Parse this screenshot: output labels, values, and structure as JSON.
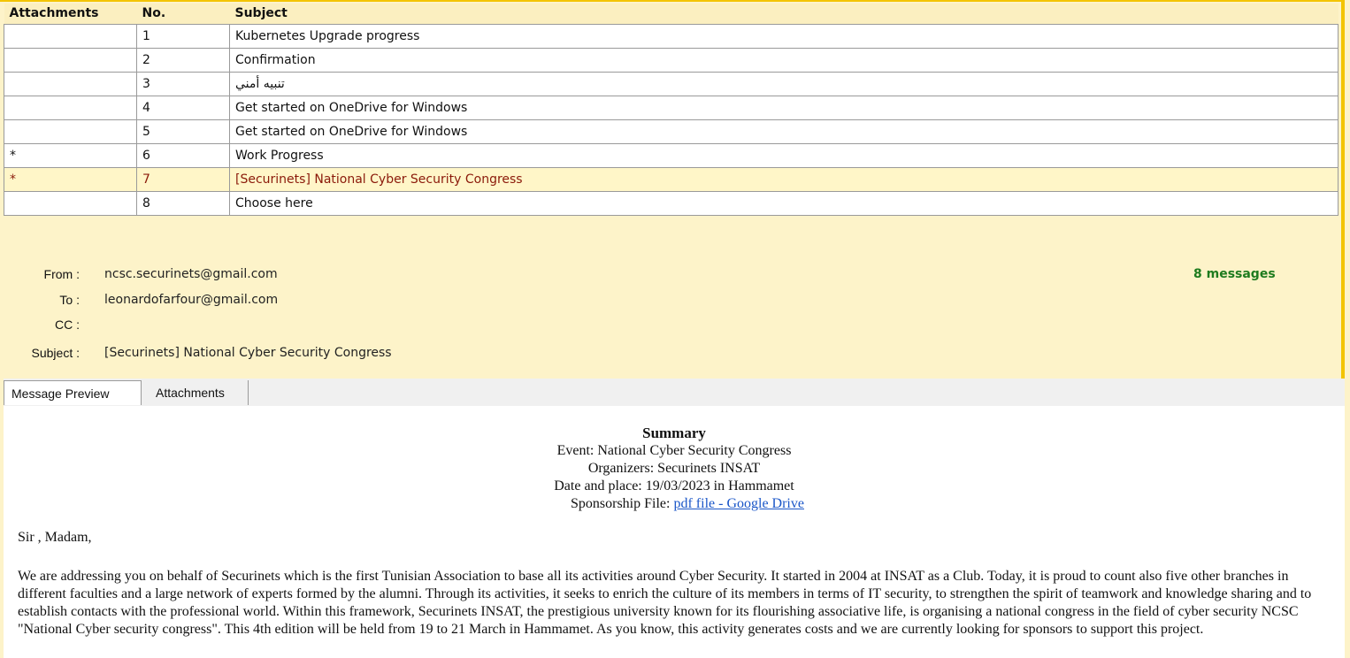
{
  "table": {
    "headers": [
      "Attachments",
      "No.",
      "Subject"
    ],
    "rows": [
      {
        "att": "",
        "no": "1",
        "subject": "Kubernetes Upgrade progress"
      },
      {
        "att": "",
        "no": "2",
        "subject": "Confirmation"
      },
      {
        "att": "",
        "no": "3",
        "subject": "تنبيه أمني"
      },
      {
        "att": "",
        "no": "4",
        "subject": "Get started on OneDrive for Windows"
      },
      {
        "att": "",
        "no": "5",
        "subject": "Get started on OneDrive for Windows"
      },
      {
        "att": "*",
        "no": "6",
        "subject": "Work Progress"
      },
      {
        "att": "*",
        "no": "7",
        "subject": "[Securinets] National Cyber Security Congress"
      },
      {
        "att": "",
        "no": "8",
        "subject": "Choose here"
      }
    ]
  },
  "message": {
    "from_label": "From :",
    "from": "ncsc.securinets@gmail.com",
    "to_label": "To :",
    "to": "leonardofarfour@gmail.com",
    "cc_label": "CC :",
    "cc": "",
    "subject_label": "Subject :",
    "subject": "[Securinets] National Cyber Security Congress",
    "count": "8 messages"
  },
  "tabs": [
    "Message Preview",
    "Attachments"
  ],
  "preview": {
    "summary_title": "Summary",
    "event": "Event: National Cyber Security Congress",
    "organizers": "Organizers: Securinets INSAT",
    "date_place": "Date and place: 19/03/2023 in Hammamet",
    "sponsorship_label": "Sponsorship File: ",
    "sponsorship_link": "pdf file - Google Drive",
    "greeting": "Sir , Madam,",
    "body": "We are addressing you on behalf of Securinets which is the first Tunisian Association to base all its activities around Cyber Security. It started in 2004 at INSAT as a Club. Today, it is proud to count also five other branches in different faculties and a large network of experts formed by the alumni. Through its activities, it seeks to enrich the culture of its members in terms of IT security, to strengthen the spirit of teamwork and knowledge sharing and to establish contacts with the professional world. Within this framework, Securinets INSAT, the prestigious university known for its flourishing associative life, is organising a national congress in the field of cyber security NCSC \"National Cyber security congress\". This 4th edition will be held from 19 to 21 March in Hammamet. As you know, this activity generates costs and we are currently looking for sponsors to support this project."
  }
}
